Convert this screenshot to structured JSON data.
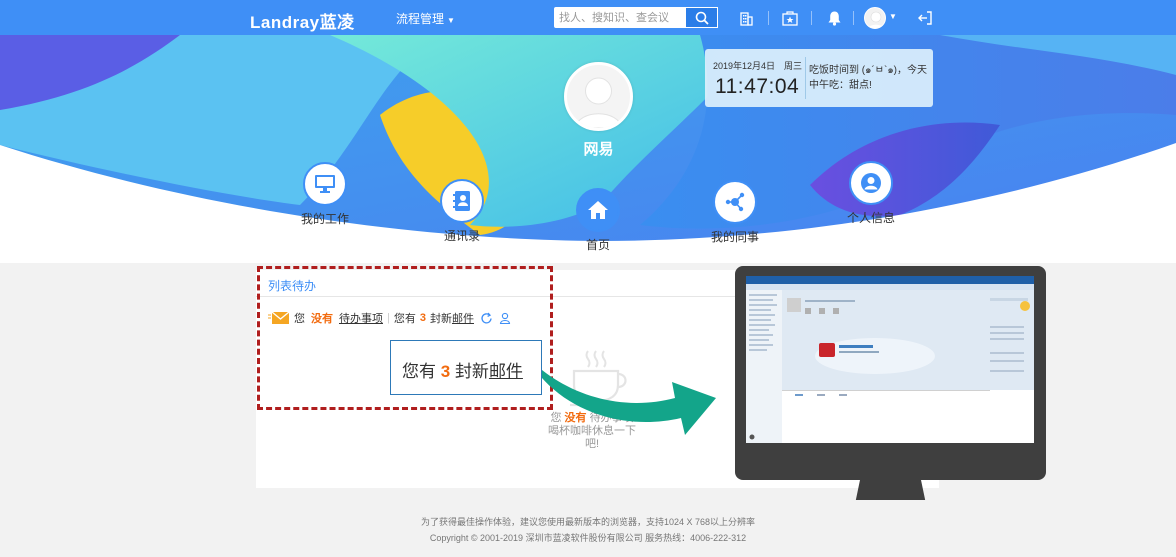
{
  "header": {
    "logo": "Landray蓝凌",
    "menu_flow": "流程管理",
    "search_placeholder": "找人、搜知识、查会议"
  },
  "user": {
    "name": "网易"
  },
  "clock": {
    "date": "2019年12月4日",
    "weekday": "周三",
    "time": "11:47:04",
    "message": "吃饭时间到 (๑´ㅂ`๑)，今天中午吃：甜点!"
  },
  "nav": {
    "my_work": "我的工作",
    "contacts": "通讯录",
    "home": "首页",
    "colleagues": "我的同事",
    "personal_info": "个人信息"
  },
  "todo_panel": {
    "title": "列表待办",
    "you": "您",
    "none": "没有",
    "todo_items": "待办事项",
    "you_have": "您有",
    "mail_count": "3",
    "mail_unit": "封新",
    "mail": "邮件",
    "empty_you": "您",
    "empty_none": "没有",
    "empty_todo": "待办事项",
    "empty_rest": "喝杯咖啡休息一下吧!"
  },
  "callout": {
    "prefix": "您有",
    "count": "3",
    "mid": "封新",
    "mail": "邮件"
  },
  "footer": {
    "line1": "为了获得最佳操作体验，建议您使用最新版本的浏览器，支持1024 X 768以上分辨率",
    "line2": "Copyright © 2001-2019 深圳市蓝凌软件股份有限公司 服务热线：4006-222-312"
  },
  "colors": {
    "accent": "#3f8ff6",
    "highlight": "#f26b0f",
    "annotation": "#b01e1e",
    "arrow": "#13a58a"
  },
  "icons": [
    "search-icon",
    "building-icon",
    "star-card-icon",
    "bell-icon",
    "logout-icon",
    "monitor-icon",
    "contacts-icon",
    "home-icon",
    "share-icon",
    "person-icon",
    "envelope-icon",
    "refresh-icon",
    "user-small-icon",
    "coffee-cup-icon"
  ]
}
